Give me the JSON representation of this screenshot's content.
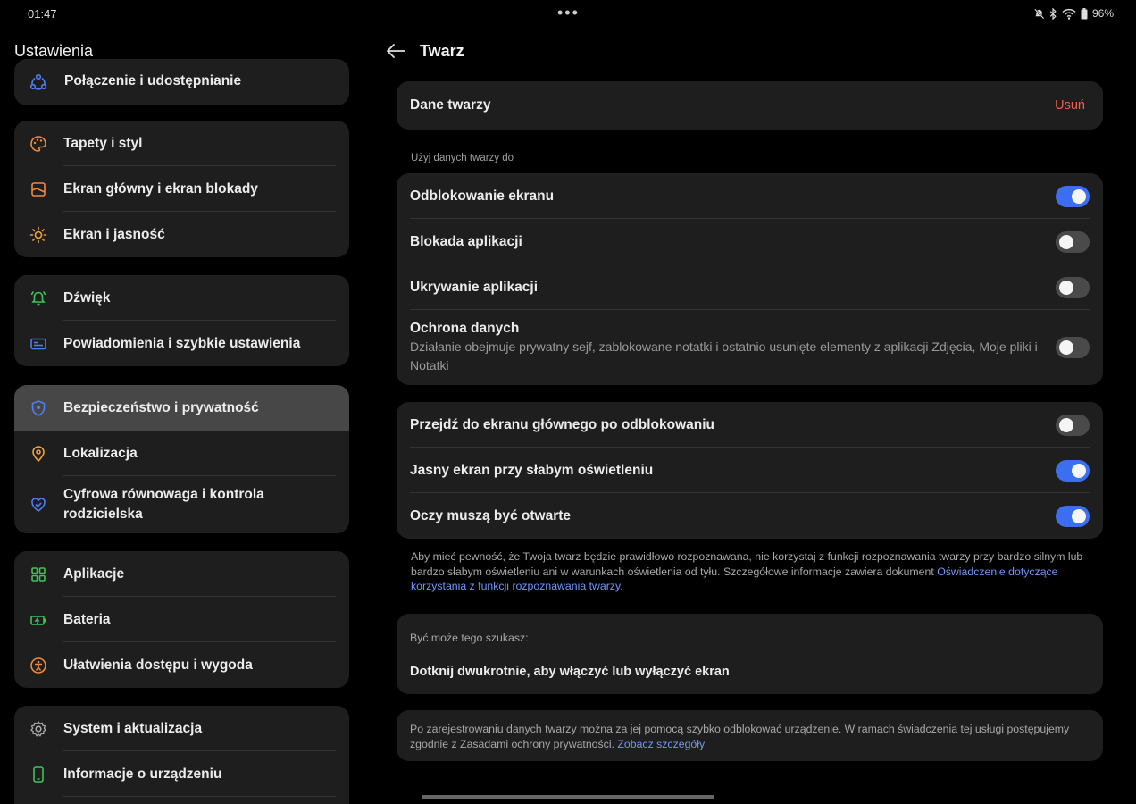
{
  "status": {
    "time": "01:47",
    "dots": "•••",
    "battery": "96%"
  },
  "left": {
    "title": "Ustawienia",
    "top_item": "Połączenie i udostępnianie",
    "group1": [
      "Tapety i styl",
      "Ekran główny i ekran blokady",
      "Ekran i jasność"
    ],
    "group2": [
      "Dźwięk",
      "Powiadomienia i szybkie ustawienia"
    ],
    "group3": [
      "Bezpieczeństwo i prywatność",
      "Lokalizacja",
      "Cyfrowa równowaga i kontrola rodzicielska"
    ],
    "group4": [
      "Aplikacje",
      "Bateria",
      "Ułatwienia dostępu i wygoda"
    ],
    "group5": [
      "System i aktualizacja",
      "Informacje o urządzeniu"
    ]
  },
  "right": {
    "title": "Twarz",
    "face_data": {
      "label": "Dane twarzy",
      "delete": "Usuń"
    },
    "section_label": "Użyj danych twarzy do",
    "uses": [
      {
        "label": "Odblokowanie ekranu",
        "on": true
      },
      {
        "label": "Blokada aplikacji",
        "on": false
      },
      {
        "label": "Ukrywanie aplikacji",
        "on": false
      },
      {
        "label": "Ochrona danych",
        "sub": "Działanie obejmuje prywatny sejf, zablokowane notatki i ostatnio usunięte elementy z aplikacji Zdjęcia, Moje pliki i Notatki",
        "on": false
      }
    ],
    "options": [
      {
        "label": "Przejdź do ekranu głównego po odblokowaniu",
        "on": false
      },
      {
        "label": "Jasny ekran przy słabym oświetleniu",
        "on": true
      },
      {
        "label": "Oczy muszą być otwarte",
        "on": true
      }
    ],
    "note_text": "Aby mieć pewność, że Twoja twarz będzie prawidłowo rozpoznawana, nie korzystaj z funkcji rozpoznawania twarzy przy bardzo silnym lub bardzo słabym oświetleniu ani w warunkach oświetlenia od tyłu. Szczegółowe informacje zawiera dokument ",
    "note_link": "Oświadczenie dotyczące korzystania z funkcji rozpoznawania twarzy",
    "note_end": ".",
    "hint_label": "Być może tego szukasz:",
    "hint_text": "Dotknij dwukrotnie, aby włączyć lub wyłączyć ekran",
    "footer_text": "Po zarejestrowaniu danych twarzy można za jej pomocą szybko odblokować urządzenie. W ramach świadczenia tej usługi postępujemy zgodnie z Zasadami ochrony prywatności. ",
    "footer_link": "Zobacz szczegóły"
  },
  "colors": {
    "accent": "#3b6ef0",
    "delete": "#f0604e",
    "link": "#6f98f5",
    "card": "#1e1e1e",
    "active": "#474747"
  },
  "icons": {
    "top_item": "share-network-icon",
    "group1": [
      "palette-icon",
      "home-lock-screen-icon",
      "brightness-sun-icon"
    ],
    "group2": [
      "bell-ringing-icon",
      "notification-panel-icon"
    ],
    "group3": [
      "shield-icon",
      "location-pin-icon",
      "digital-wellbeing-icon"
    ],
    "group4": [
      "apps-grid-icon",
      "battery-icon",
      "accessibility-icon"
    ],
    "group5": [
      "gear-icon",
      "phone-info-icon"
    ]
  }
}
